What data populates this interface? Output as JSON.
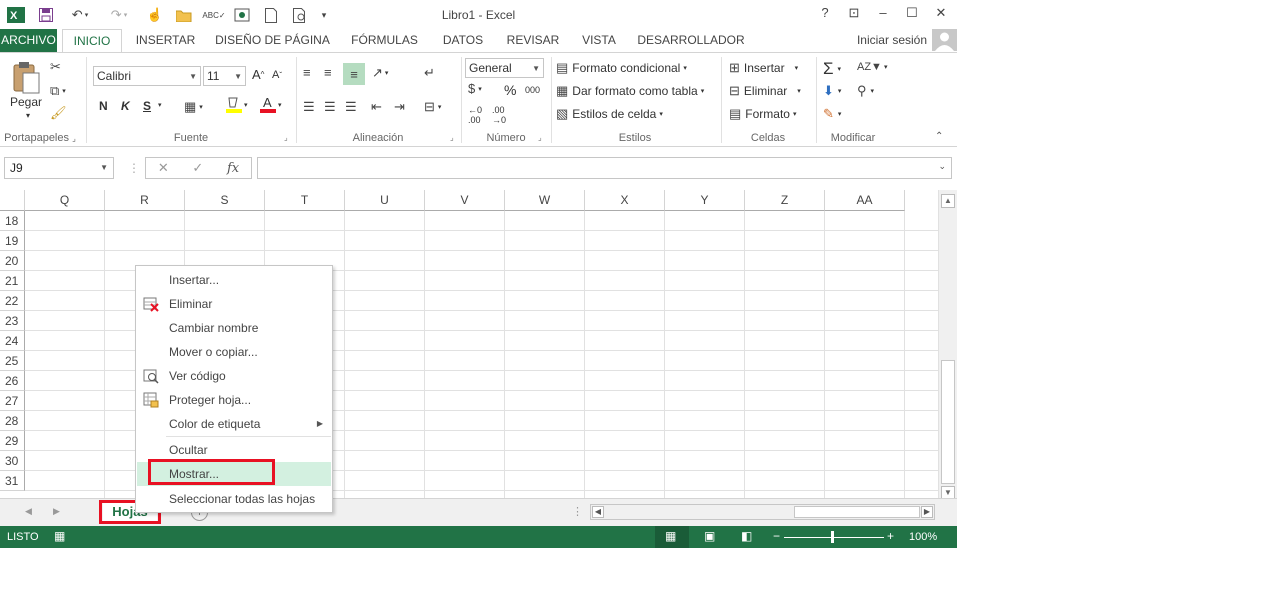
{
  "window": {
    "title": "Libro1 - Excel",
    "help": "?",
    "controls": [
      "⊡",
      "–",
      "☐",
      "✕"
    ]
  },
  "ribbon_tabs": [
    "ARCHIVO",
    "INICIO",
    "INSERTAR",
    "DISEÑO DE PÁGINA",
    "FÓRMULAS",
    "DATOS",
    "REVISAR",
    "VISTA",
    "DESARROLLADOR"
  ],
  "signin": "Iniciar sesión",
  "ribbon": {
    "clipboard": {
      "paste": "Pegar",
      "label": "Portapapeles"
    },
    "font": {
      "name": "Calibri",
      "size": "11",
      "bold": "N",
      "italic": "K",
      "underline": "S",
      "label": "Fuente"
    },
    "alignment": {
      "label": "Alineación"
    },
    "number": {
      "format": "General",
      "currency": "$",
      "percent": "%",
      "thousands": "000",
      "label": "Número"
    },
    "styles": {
      "conditional": "Formato condicional",
      "table": "Dar formato como tabla",
      "cell_styles": "Estilos de celda",
      "label": "Estilos"
    },
    "cells": {
      "insert": "Insertar",
      "delete": "Eliminar",
      "format": "Formato",
      "label": "Celdas"
    },
    "editing": {
      "label": "Modificar"
    }
  },
  "formula_bar": {
    "name_box": "J9",
    "fx": "fx"
  },
  "columns": [
    "Q",
    "R",
    "S",
    "T",
    "U",
    "V",
    "W",
    "X",
    "Y",
    "Z",
    "AA"
  ],
  "rows": [
    "18",
    "19",
    "20",
    "21",
    "22",
    "23",
    "24",
    "25",
    "26",
    "27",
    "28",
    "29",
    "30",
    "31"
  ],
  "sheet_tab": "Hojas",
  "status": {
    "ready": "LISTO",
    "zoom": "100%"
  },
  "context_menu": {
    "items": [
      {
        "label": "Insertar...",
        "icon": ""
      },
      {
        "label": "Eliminar",
        "icon": "delete-sheet-icon"
      },
      {
        "label": "Cambiar nombre",
        "icon": ""
      },
      {
        "label": "Mover o copiar...",
        "icon": ""
      },
      {
        "label": "Ver código",
        "icon": "view-code-icon"
      },
      {
        "label": "Proteger hoja...",
        "icon": "protect-sheet-icon"
      },
      {
        "label": "Color de etiqueta",
        "icon": ""
      },
      {
        "label": "Ocultar",
        "icon": ""
      },
      {
        "label": "Mostrar...",
        "icon": ""
      },
      {
        "label": "Seleccionar todas las hojas",
        "icon": ""
      }
    ]
  },
  "colors": {
    "excel_green": "#217346",
    "highlight_red": "#e81123",
    "menu_hover": "#d3f0e0"
  }
}
